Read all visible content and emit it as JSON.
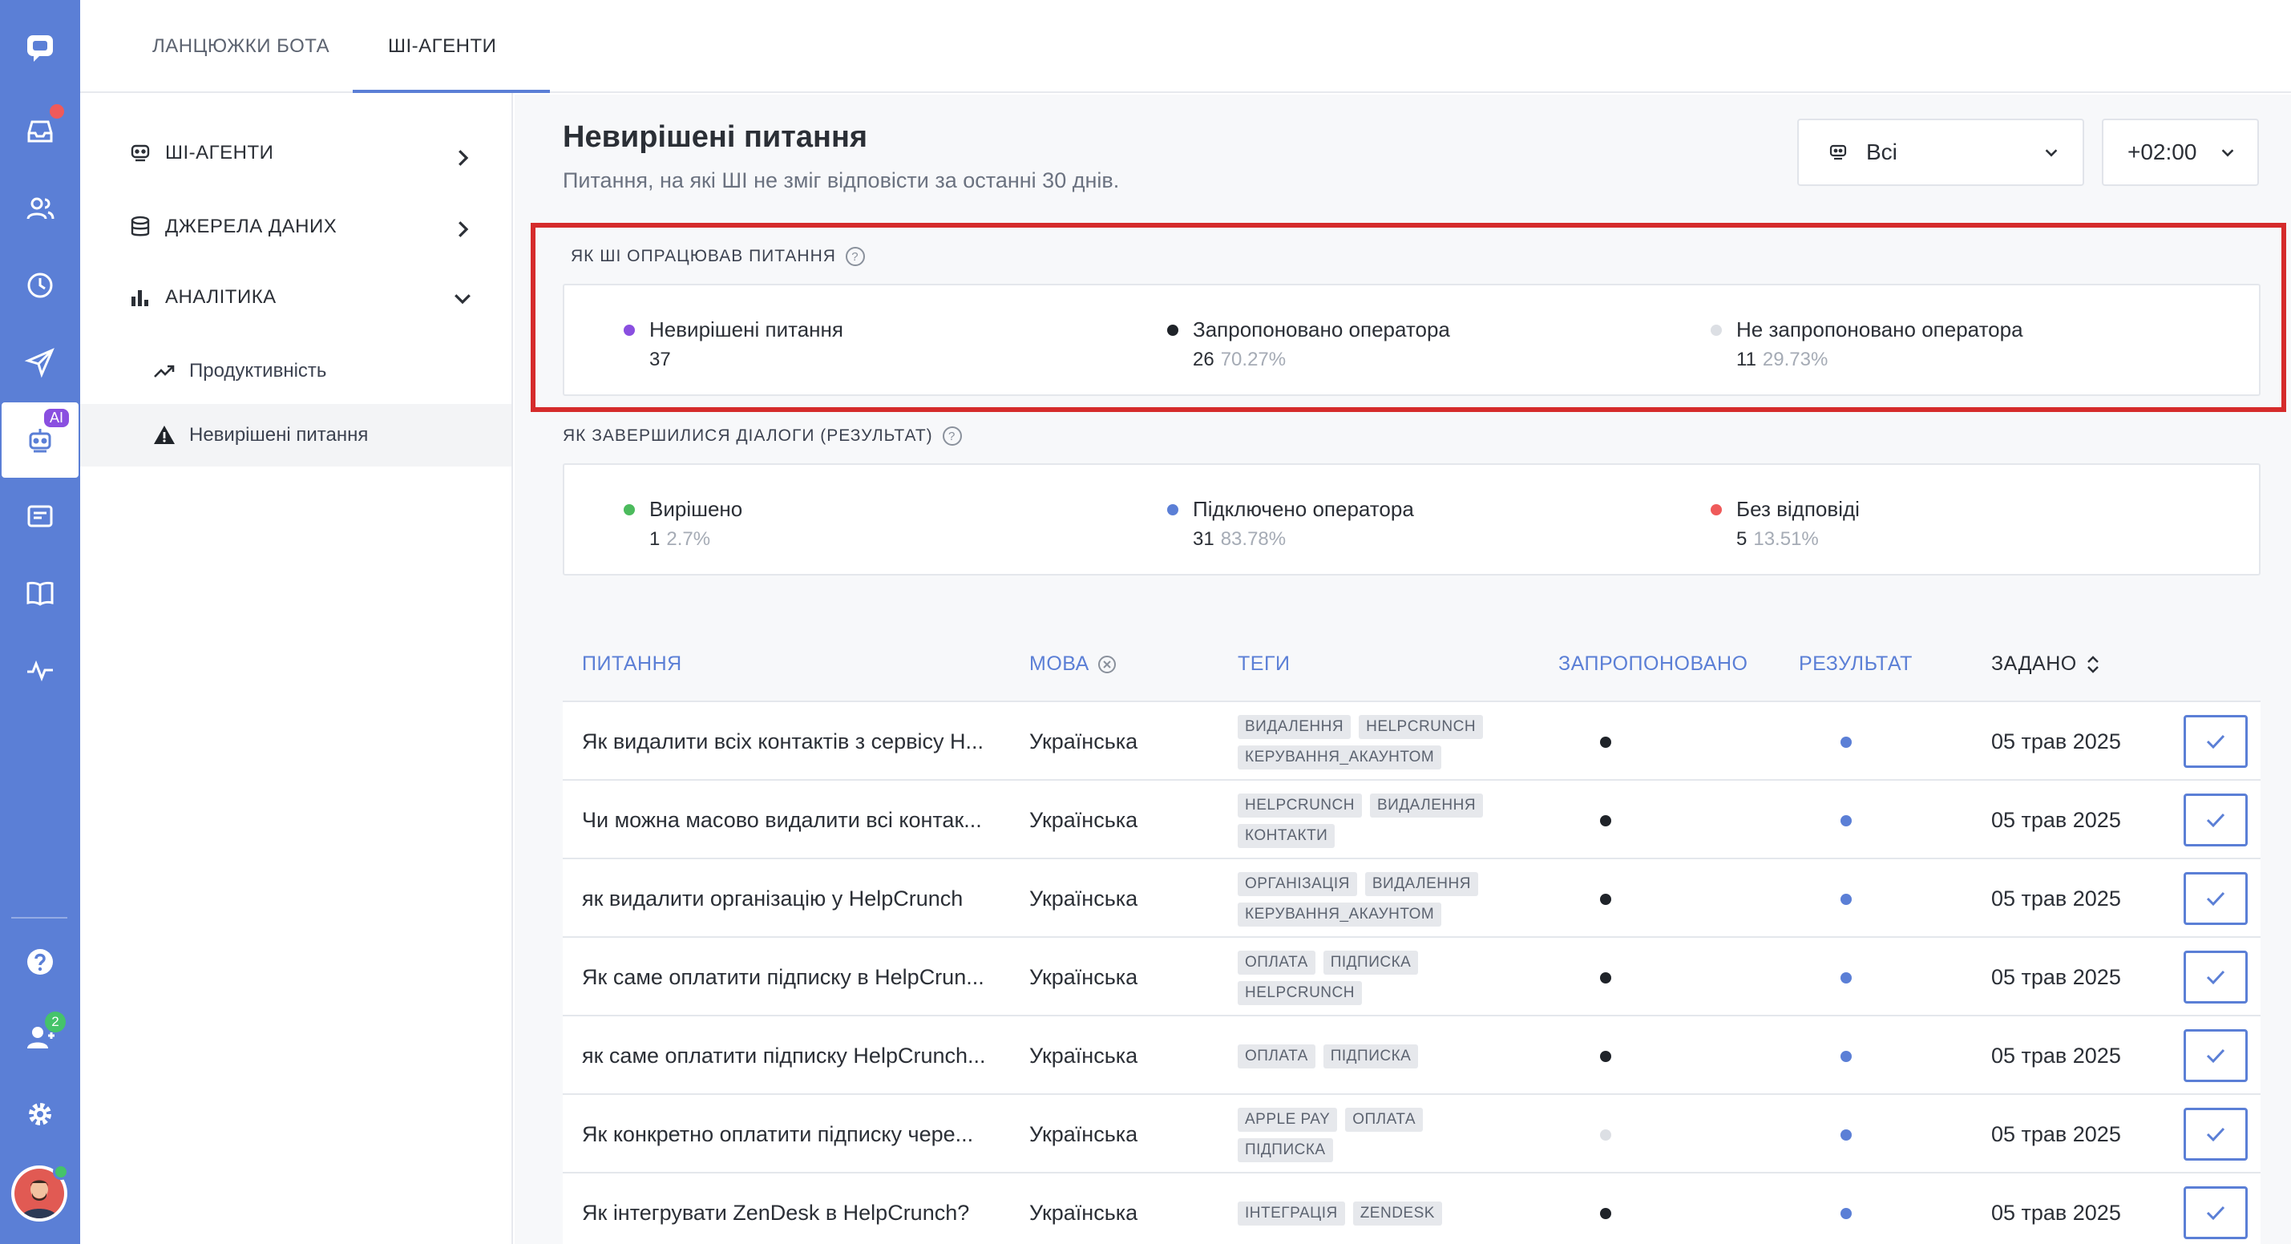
{
  "top_tabs": [
    {
      "label": "ЛАНЦЮЖКИ БОТА",
      "active": false
    },
    {
      "label": "ШІ-АГЕНТИ",
      "active": true
    }
  ],
  "sidebar": {
    "items": [
      {
        "label": "ШІ-АГЕНТИ",
        "icon": "bot-icon",
        "expanded": false
      },
      {
        "label": "ДЖЕРЕЛА ДАНИХ",
        "icon": "database-icon",
        "expanded": false
      },
      {
        "label": "АНАЛІТИКА",
        "icon": "bar-chart-icon",
        "expanded": true
      }
    ],
    "sub_items": [
      {
        "label": "Продуктивність",
        "icon": "trend-up-icon",
        "active": false
      },
      {
        "label": "Невирішені питання",
        "icon": "warning-icon",
        "active": true
      }
    ]
  },
  "rail": {
    "ai_badge": "AI",
    "team_badge": "2"
  },
  "page": {
    "title": "Невирішені питання",
    "subtitle": "Питання, на які ШІ не зміг відповісти за останні 30 днів.",
    "filter_agent": "Всі",
    "timezone": "+02:00"
  },
  "handled": {
    "label": "ЯК ШІ ОПРАЦЮВАВ ПИТАННЯ",
    "stats": [
      {
        "title": "Невирішені питання",
        "value": "37",
        "pct": "",
        "color": "#8a4fe0"
      },
      {
        "title": "Запропоновано оператора",
        "value": "26",
        "pct": "70.27%",
        "color": "#1f2329"
      },
      {
        "title": "Не запропоновано оператора",
        "value": "11",
        "pct": "29.73%",
        "color": "#dcdfe4"
      }
    ]
  },
  "outcome": {
    "label": "ЯК ЗАВЕРШИЛИСЯ ДІАЛОГИ (РЕЗУЛЬТАТ)",
    "stats": [
      {
        "title": "Вирішено",
        "value": "1",
        "pct": "2.7%",
        "color": "#4cbb5d"
      },
      {
        "title": "Підключено оператора",
        "value": "31",
        "pct": "83.78%",
        "color": "#5b7fd6"
      },
      {
        "title": "Без відповіді",
        "value": "5",
        "pct": "13.51%",
        "color": "#ef5a5a"
      }
    ]
  },
  "table": {
    "headers": {
      "question": "ПИТАННЯ",
      "language": "МОВА",
      "tags": "ТЕГИ",
      "proposed": "ЗАПРОПОНОВАНО",
      "result": "РЕЗУЛЬТАТ",
      "asked": "ЗАДАНО"
    },
    "rows": [
      {
        "question": "Як видалити всіх контактів з сервісу Н...",
        "language": "Українська",
        "tags": [
          "ВИДАЛЕННЯ",
          "HELPCRUNCH",
          "КЕРУВАННЯ_АКАУНТОМ"
        ],
        "proposed_color": "#1f2329",
        "result_color": "#5b7fd6",
        "date": "05 трав 2025"
      },
      {
        "question": "Чи можна масово видалити всі контак...",
        "language": "Українська",
        "tags": [
          "HELPCRUNCH",
          "ВИДАЛЕННЯ",
          "КОНТАКТИ"
        ],
        "proposed_color": "#1f2329",
        "result_color": "#5b7fd6",
        "date": "05 трав 2025"
      },
      {
        "question": "як видалити організацію у HelpCrunch",
        "language": "Українська",
        "tags": [
          "ОРГАНІЗАЦІЯ",
          "ВИДАЛЕННЯ",
          "КЕРУВАННЯ_АКАУНТОМ"
        ],
        "proposed_color": "#1f2329",
        "result_color": "#5b7fd6",
        "date": "05 трав 2025"
      },
      {
        "question": "Як саме оплатити підписку в HelpCrun...",
        "language": "Українська",
        "tags": [
          "ОПЛАТА",
          "ПІДПИСКА",
          "HELPCRUNCH"
        ],
        "proposed_color": "#1f2329",
        "result_color": "#5b7fd6",
        "date": "05 трав 2025"
      },
      {
        "question": "як саме оплатити підписку HelpCrunch...",
        "language": "Українська",
        "tags": [
          "ОПЛАТА",
          "ПІДПИСКА"
        ],
        "proposed_color": "#1f2329",
        "result_color": "#5b7fd6",
        "date": "05 трав 2025"
      },
      {
        "question": "Як конкретно оплатити підписку чере...",
        "language": "Українська",
        "tags": [
          "APPLE PAY",
          "ОПЛАТА",
          "ПІДПИСКА"
        ],
        "proposed_color": "#dcdfe4",
        "result_color": "#5b7fd6",
        "date": "05 трав 2025"
      },
      {
        "question": "Як інтегрувати ZenDesk в HelpCrunch?",
        "language": "Українська",
        "tags": [
          "ІНТЕГРАЦІЯ",
          "ZENDESK"
        ],
        "proposed_color": "#1f2329",
        "result_color": "#5b7fd6",
        "date": "05 трав 2025"
      }
    ]
  }
}
